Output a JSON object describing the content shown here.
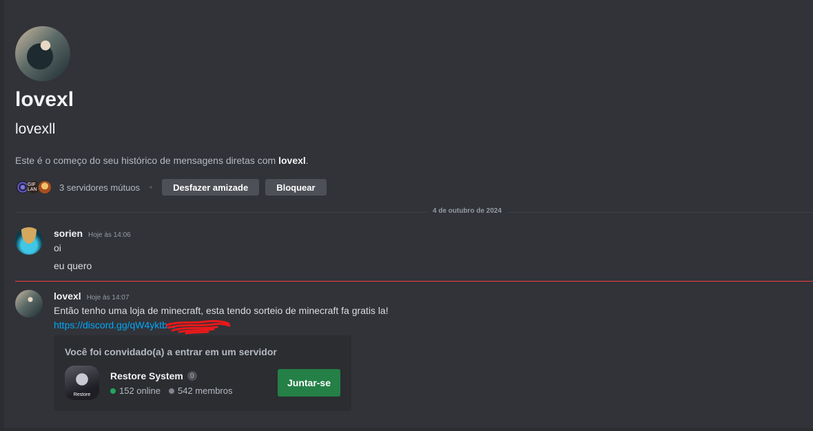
{
  "profile": {
    "display_name": "lovexl",
    "username": "lovexll",
    "intro_prefix": "Este é o começo do seu histórico de mensagens diretas com ",
    "intro_name": "lovexl",
    "intro_suffix": ".",
    "mutual_servers_label": "3 servidores mútuos",
    "mutual_server_icons": [
      "server-spiral-icon",
      "server-gif-icon",
      "server-character-icon"
    ],
    "mutual_server_icon_text": [
      "",
      "GIF LAN",
      ""
    ],
    "unfriend_label": "Desfazer amizade",
    "block_label": "Bloquear"
  },
  "date_divider": "4 de outubro de 2024",
  "messages": [
    {
      "author": "sorien",
      "timestamp": "Hoje às 14:06",
      "lines": [
        "oi",
        "eu quero"
      ]
    },
    {
      "author": "lovexl",
      "timestamp": "Hoje às 14:07",
      "lines": [
        "Então tenho uma loja de minecraft, esta tendo sorteio de minecraft fa gratis la!"
      ],
      "link": "https://discord.gg/qW4yktb..."
    }
  ],
  "invite": {
    "header": "Você foi convidado(a) a entrar em um servidor",
    "server_name": "Restore System",
    "server_icon_text": "Restore",
    "partner_badge": "0",
    "online": "152 online",
    "members": "542 membros",
    "join_label": "Juntar-se"
  },
  "colors": {
    "background": "#313338",
    "link": "#00a8fc",
    "join_button": "#248046",
    "new_messages_line": "#f23f43",
    "online_dot": "#23a55a"
  }
}
